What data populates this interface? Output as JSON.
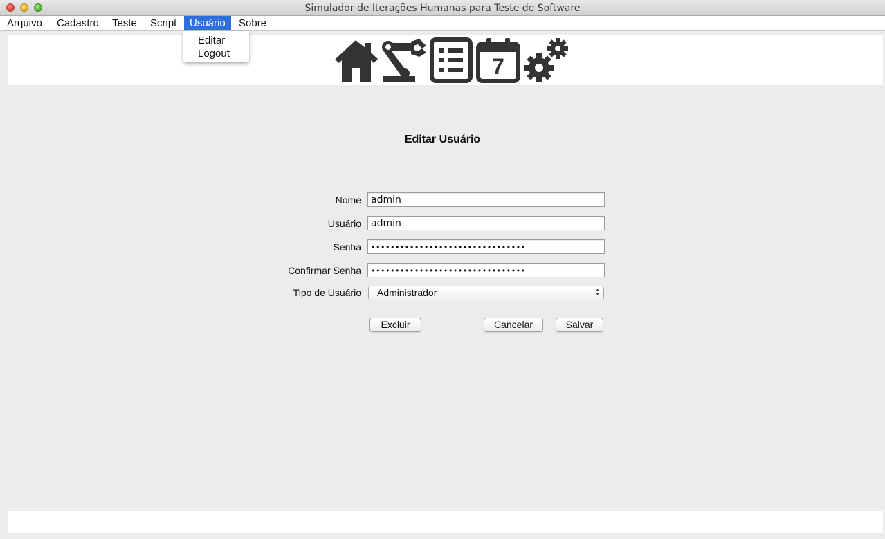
{
  "window": {
    "title": "Simulador de Iterações Humanas para Teste de Software"
  },
  "menubar": {
    "items": [
      {
        "label": "Arquivo"
      },
      {
        "label": "Cadastro"
      },
      {
        "label": "Teste"
      },
      {
        "label": "Script"
      },
      {
        "label": "Usuário",
        "active": true
      },
      {
        "label": "Sobre"
      }
    ],
    "dropdown": [
      "Editar",
      "Logout"
    ]
  },
  "toolbar": {
    "icons": [
      "home-icon",
      "robot-arm-icon",
      "list-icon",
      "calendar-icon",
      "gears-icon"
    ],
    "calendar_day": "7"
  },
  "form": {
    "title": "Editar Usuário",
    "fields": [
      {
        "label": "Nome",
        "value": "admin"
      },
      {
        "label": "Usuário",
        "value": "admin"
      },
      {
        "label": "Senha",
        "value": "••••••••••••••••••••••••••••••••"
      },
      {
        "label": "Confirmar Senha",
        "value": "••••••••••••••••••••••••••••••••"
      }
    ],
    "type_label": "Tipo de Usuário",
    "type_value": "Administrador",
    "buttons": {
      "delete": "Excluir",
      "cancel": "Cancelar",
      "save": "Salvar"
    }
  },
  "colors": {
    "menu_active": "#2f6fdc",
    "background": "#ececec",
    "icon": "#333333"
  }
}
